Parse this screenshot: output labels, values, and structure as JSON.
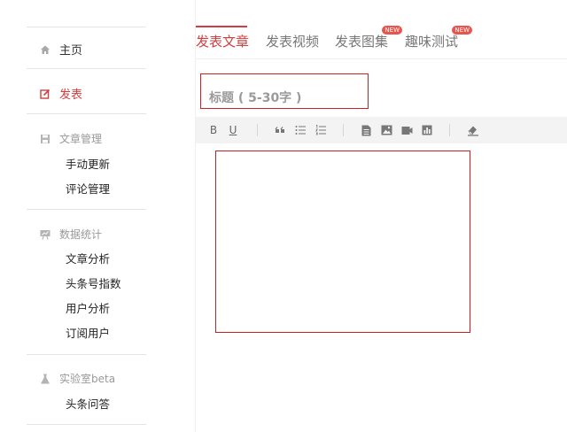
{
  "sidebar": {
    "home": "主页",
    "publish": "发表",
    "article_mgmt": {
      "label": "文章管理",
      "items": [
        "手动更新",
        "评论管理"
      ]
    },
    "stats": {
      "label": "数据统计",
      "items": [
        "文章分析",
        "头条号指数",
        "用户分析",
        "订阅用户"
      ]
    },
    "lab": {
      "label": "实验室beta",
      "items": [
        "头条问答"
      ]
    }
  },
  "tabs": [
    {
      "label": "发表文章",
      "selected": true
    },
    {
      "label": "发表视频"
    },
    {
      "label": "发表图集",
      "badge": "NEW"
    },
    {
      "label": "趣味测试",
      "badge": "NEW"
    }
  ],
  "editor": {
    "title_placeholder": "标题 ( 5-30字 )",
    "toolbar_icons": [
      "bold-icon",
      "underline-icon",
      "quote-icon",
      "bullet-list-icon",
      "numbered-list-icon",
      "document-icon",
      "image-icon",
      "video-icon",
      "chart-icon",
      "clear-format-icon"
    ],
    "bold_glyph": "B",
    "underline_glyph": "U"
  },
  "colors": {
    "accent": "#d43d3d",
    "highlight_box": "#cc2020",
    "badge": "#e8554e"
  }
}
